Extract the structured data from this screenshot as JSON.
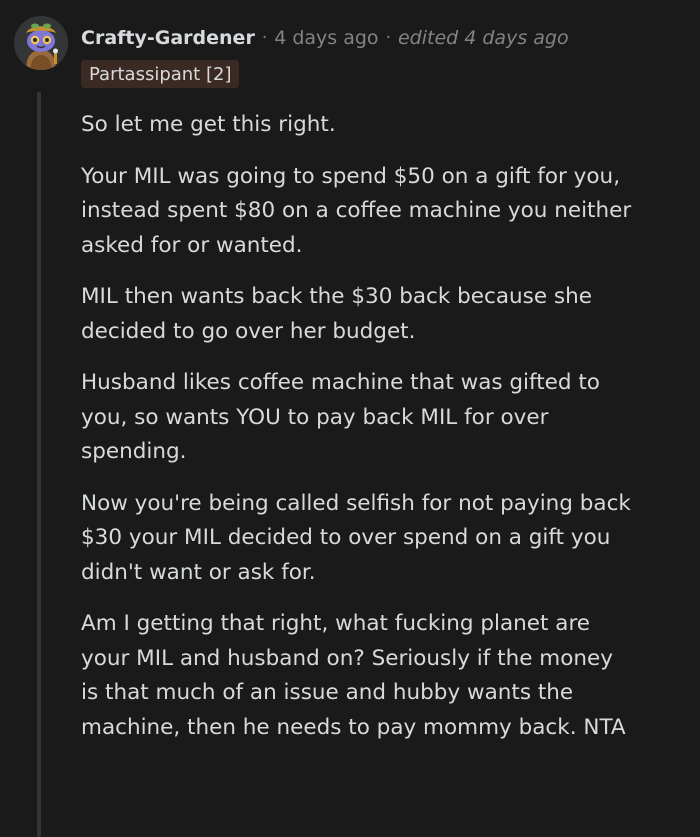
{
  "comment": {
    "username": "Crafty-Gardener",
    "separator": "·",
    "timestamp": "4 days ago",
    "edited": "edited 4 days ago",
    "flair": "Partassipant [2]",
    "paragraphs": [
      "So let me get this right.",
      "Your MIL was going to spend $50 on a gift for you,\ninstead spent $80 on a coffee machine you neither\nasked for or wanted.",
      "MIL then wants back the $30 back because she\ndecided to go over her budget.",
      "Husband likes coffee machine that was gifted to\nyou, so wants YOU to pay back MIL for over\nspending.",
      "Now you're being called selfish for not paying back\n$30 your MIL decided to over spend on a gift you\ndidn't want or ask for.",
      "Am I getting that right, what fucking planet are\nyour MIL and husband on? Seriously if the money\nis that much of an issue and hubby wants the\nmachine, then he needs to pay mommy back. NTA"
    ]
  },
  "colors": {
    "background": "#1a1a1b",
    "text": "#d7dadc",
    "muted": "#818384",
    "flair_bg": "#3b2a24",
    "thread_line": "#343536"
  },
  "icons": {
    "avatar": "snoo-avatar-icon"
  }
}
